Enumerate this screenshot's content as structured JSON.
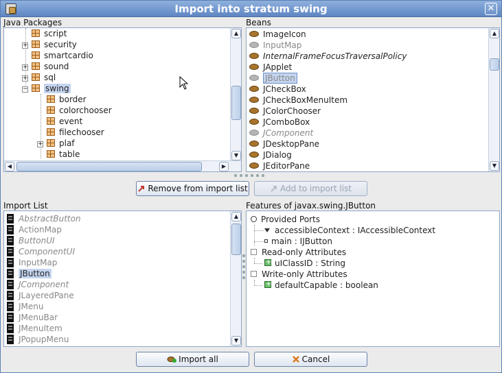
{
  "window": {
    "title": "Import into stratum swing",
    "close_glyph": "✕"
  },
  "java_packages": {
    "label": "Java Packages",
    "items": [
      {
        "name": "script",
        "expandable": false
      },
      {
        "name": "security",
        "expandable": true
      },
      {
        "name": "smartcardio",
        "expandable": false
      },
      {
        "name": "sound",
        "expandable": true
      },
      {
        "name": "sql",
        "expandable": true
      },
      {
        "name": "swing",
        "expandable": true,
        "expanded": true,
        "selected": true
      },
      {
        "name": "border",
        "expandable": false
      },
      {
        "name": "colorchooser",
        "expandable": false
      },
      {
        "name": "event",
        "expandable": false
      },
      {
        "name": "filechooser",
        "expandable": false
      },
      {
        "name": "plaf",
        "expandable": true
      },
      {
        "name": "table",
        "expandable": false
      }
    ]
  },
  "beans": {
    "label": "Beans",
    "items": [
      {
        "name": "ImageIcon",
        "style": "normal"
      },
      {
        "name": "InputMap",
        "style": "muted"
      },
      {
        "name": "InternalFrameFocusTraversalPolicy",
        "style": "italic"
      },
      {
        "name": "JApplet",
        "style": "normal"
      },
      {
        "name": "JButton",
        "style": "selected"
      },
      {
        "name": "JCheckBox",
        "style": "normal"
      },
      {
        "name": "JCheckBoxMenuItem",
        "style": "normal"
      },
      {
        "name": "JColorChooser",
        "style": "normal"
      },
      {
        "name": "JComboBox",
        "style": "normal"
      },
      {
        "name": "JComponent",
        "style": "muted-italic"
      },
      {
        "name": "JDesktopPane",
        "style": "normal"
      },
      {
        "name": "JDialog",
        "style": "normal"
      },
      {
        "name": "JEditorPane",
        "style": "normal"
      }
    ]
  },
  "buttons": {
    "remove_label": "Remove from import list",
    "add_label": "Add to import list",
    "import_all_label": "Import all",
    "cancel_label": "Cancel"
  },
  "import_list": {
    "label": "Import List",
    "items": [
      {
        "name": "AbstractButton",
        "style": "muted-italic"
      },
      {
        "name": "ActionMap",
        "style": "muted"
      },
      {
        "name": "ButtonUI",
        "style": "muted-italic"
      },
      {
        "name": "ComponentUI",
        "style": "muted-italic"
      },
      {
        "name": "InputMap",
        "style": "muted"
      },
      {
        "name": "JButton",
        "style": "selected"
      },
      {
        "name": "JComponent",
        "style": "muted-italic"
      },
      {
        "name": "JLayeredPane",
        "style": "muted"
      },
      {
        "name": "JMenu",
        "style": "muted"
      },
      {
        "name": "JMenuBar",
        "style": "muted"
      },
      {
        "name": "JMenuItem",
        "style": "muted"
      },
      {
        "name": "JPopupMenu",
        "style": "muted"
      }
    ]
  },
  "features": {
    "label": "Features of javax.swing.JButton",
    "provided_ports": "Provided Ports",
    "port1": "accessibleContext : IAccessibleContext",
    "port2": "main : IJButton",
    "readonly_attrs": "Read-only Attributes",
    "ro_attr1": "uIClassID : String",
    "writeonly_attrs": "Write-only Attributes",
    "wo_attr1": "defaultCapable : boolean"
  },
  "colors": {
    "title_bar": "#5f86c3",
    "selection": "#c5d5f0",
    "panel_border": "#8fa6c6"
  }
}
